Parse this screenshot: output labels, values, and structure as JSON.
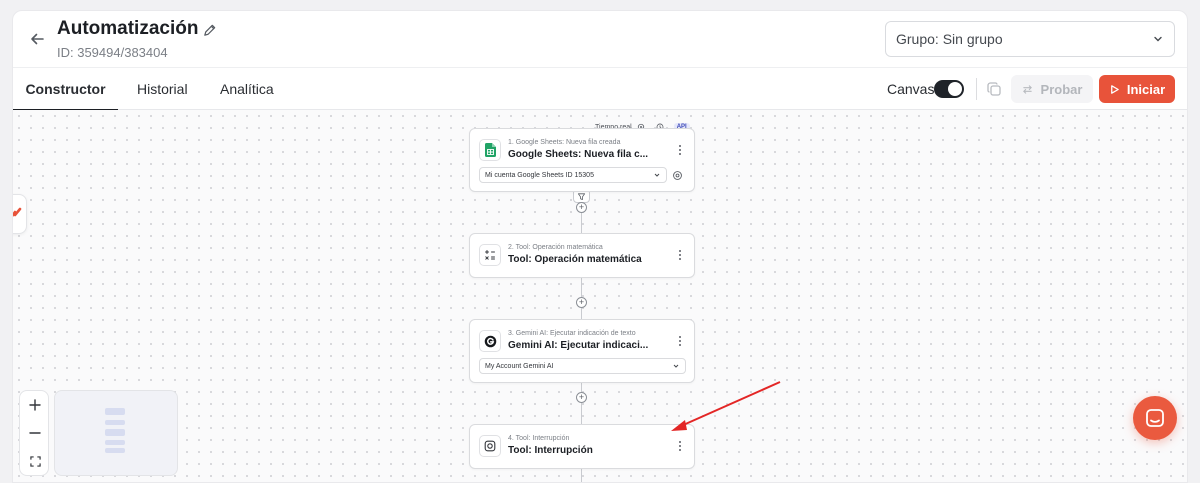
{
  "header": {
    "title": "Automatización",
    "id_text": "ID: 359494/383404",
    "group_select": "Grupo: Sin grupo"
  },
  "tabs": [
    {
      "label": "Constructor",
      "active": true
    },
    {
      "label": "Historial",
      "active": false
    },
    {
      "label": "Analítica",
      "active": false
    }
  ],
  "toolbar": {
    "canvas_label": "Canvas",
    "canvas_toggle": "on",
    "test_label": "Probar",
    "start_label": "Iniciar"
  },
  "canvas": {
    "realtime_label": "Tiempo real",
    "api_badge": "API",
    "nodes": [
      {
        "subtitle": "1. Google Sheets: Nueva fila creada",
        "title": "Google Sheets: Nueva fila c...",
        "select": "Mi cuenta Google Sheets ID 15305",
        "icon": "google-sheets-icon"
      },
      {
        "subtitle": "2. Tool: Operación matemática",
        "title": "Tool: Operación matemática",
        "icon": "math-operation-icon"
      },
      {
        "subtitle": "3. Gemini AI: Ejecutar indicación de texto",
        "title": "Gemini AI: Ejecutar indicaci...",
        "select": "My Account Gemini AI",
        "icon": "gemini-icon"
      },
      {
        "subtitle": "4. Tool: Interrupción",
        "title": "Tool: Interrupción",
        "icon": "interruption-icon"
      }
    ]
  },
  "colors": {
    "accent": "#e8533a",
    "annotation_arrow": "#e32626",
    "toggle_on": "#1f2329",
    "sheets_green": "#21a366"
  }
}
